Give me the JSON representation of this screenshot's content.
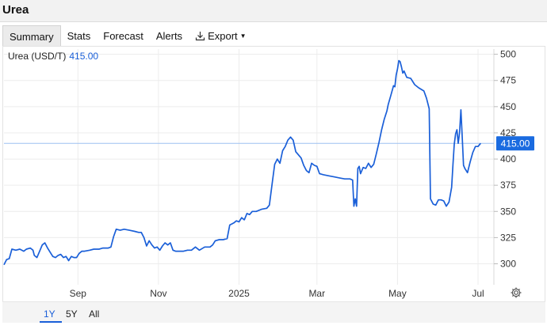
{
  "page": {
    "title": "Urea"
  },
  "tabs": [
    {
      "label": "Summary",
      "active": true
    },
    {
      "label": "Stats"
    },
    {
      "label": "Forecast"
    },
    {
      "label": "Alerts"
    },
    {
      "label": "Export",
      "icon": "download-icon"
    }
  ],
  "legend": {
    "name": "Urea (USD/T)",
    "value": "415.00"
  },
  "range_buttons": [
    {
      "label": "1Y",
      "active": true
    },
    {
      "label": "5Y"
    },
    {
      "label": "All"
    }
  ],
  "colors": {
    "line": "#1a5fd8",
    "grid": "#ececec",
    "ref_line": "#9ec0f0",
    "price_tag": "#1a6be0"
  },
  "icons": {
    "settings": "gear-icon"
  },
  "chart_data": {
    "type": "line",
    "title": "",
    "xlabel": "",
    "ylabel": "",
    "series": [
      {
        "name": "Urea (USD/T)"
      }
    ],
    "x_ticks": [
      "Sep",
      "Nov",
      "2025",
      "Mar",
      "May",
      "Jul"
    ],
    "x_tick_dates": [
      "2024-09-01",
      "2024-11-01",
      "2025-01-01",
      "2025-03-01",
      "2025-05-01",
      "2025-07-01"
    ],
    "y_ticks": [
      300,
      325,
      350,
      375,
      400,
      425,
      450,
      475,
      500
    ],
    "ylim": [
      280,
      505
    ],
    "xlim": [
      "2024-07-07",
      "2025-07-13"
    ],
    "last_value": 415.0,
    "last_value_label": "415.00",
    "grid": true,
    "y_axis_position": "right",
    "points": [
      [
        "2024-07-07",
        299
      ],
      [
        "2024-07-09",
        304
      ],
      [
        "2024-07-11",
        305
      ],
      [
        "2024-07-13",
        314
      ],
      [
        "2024-07-16",
        313
      ],
      [
        "2024-07-19",
        314
      ],
      [
        "2024-07-22",
        312
      ],
      [
        "2024-07-24",
        314
      ],
      [
        "2024-07-27",
        315
      ],
      [
        "2024-07-29",
        313
      ],
      [
        "2024-07-30",
        308
      ],
      [
        "2024-08-01",
        306
      ],
      [
        "2024-08-03",
        312
      ],
      [
        "2024-08-05",
        318
      ],
      [
        "2024-08-07",
        320
      ],
      [
        "2024-08-09",
        315
      ],
      [
        "2024-08-11",
        311
      ],
      [
        "2024-08-13",
        307
      ],
      [
        "2024-08-15",
        306
      ],
      [
        "2024-08-17",
        308
      ],
      [
        "2024-08-19",
        309
      ],
      [
        "2024-08-21",
        306
      ],
      [
        "2024-08-23",
        307
      ],
      [
        "2024-08-25",
        303
      ],
      [
        "2024-08-27",
        307
      ],
      [
        "2024-08-29",
        306
      ],
      [
        "2024-08-31",
        306
      ],
      [
        "2024-09-02",
        310
      ],
      [
        "2024-09-04",
        312
      ],
      [
        "2024-09-06",
        312
      ],
      [
        "2024-09-10",
        313
      ],
      [
        "2024-09-13",
        314
      ],
      [
        "2024-09-17",
        314
      ],
      [
        "2024-09-20",
        315
      ],
      [
        "2024-09-24",
        315
      ],
      [
        "2024-09-26",
        316
      ],
      [
        "2024-09-28",
        326
      ],
      [
        "2024-09-30",
        333
      ],
      [
        "2024-10-03",
        332
      ],
      [
        "2024-10-06",
        333
      ],
      [
        "2024-10-10",
        332
      ],
      [
        "2024-10-14",
        331
      ],
      [
        "2024-10-17",
        330
      ],
      [
        "2024-10-19",
        330
      ],
      [
        "2024-10-21",
        325
      ],
      [
        "2024-10-23",
        317
      ],
      [
        "2024-10-25",
        322
      ],
      [
        "2024-10-27",
        318
      ],
      [
        "2024-10-29",
        315
      ],
      [
        "2024-10-31",
        316
      ],
      [
        "2024-11-02",
        313
      ],
      [
        "2024-11-04",
        317
      ],
      [
        "2024-11-06",
        320
      ],
      [
        "2024-11-08",
        318
      ],
      [
        "2024-11-10",
        320
      ],
      [
        "2024-11-12",
        313
      ],
      [
        "2024-11-14",
        312
      ],
      [
        "2024-11-17",
        312
      ],
      [
        "2024-11-20",
        312
      ],
      [
        "2024-11-23",
        313
      ],
      [
        "2024-11-26",
        313
      ],
      [
        "2024-11-29",
        316
      ],
      [
        "2024-12-02",
        313
      ],
      [
        "2024-12-06",
        316
      ],
      [
        "2024-12-10",
        316
      ],
      [
        "2024-12-12",
        318
      ],
      [
        "2024-12-14",
        322
      ],
      [
        "2024-12-17",
        323
      ],
      [
        "2024-12-20",
        323
      ],
      [
        "2024-12-23",
        324
      ],
      [
        "2024-12-25",
        337
      ],
      [
        "2024-12-28",
        339
      ],
      [
        "2024-12-30",
        341
      ],
      [
        "2025-01-01",
        340
      ],
      [
        "2025-01-03",
        344
      ],
      [
        "2025-01-05",
        342
      ],
      [
        "2025-01-07",
        348
      ],
      [
        "2025-01-09",
        347
      ],
      [
        "2025-01-11",
        350
      ],
      [
        "2025-01-14",
        350
      ],
      [
        "2025-01-18",
        352
      ],
      [
        "2025-01-22",
        353
      ],
      [
        "2025-01-24",
        356
      ],
      [
        "2025-01-26",
        376
      ],
      [
        "2025-01-28",
        395
      ],
      [
        "2025-01-30",
        400
      ],
      [
        "2025-02-01",
        396
      ],
      [
        "2025-02-03",
        408
      ],
      [
        "2025-02-05",
        412
      ],
      [
        "2025-02-07",
        418
      ],
      [
        "2025-02-09",
        421
      ],
      [
        "2025-02-11",
        418
      ],
      [
        "2025-02-13",
        407
      ],
      [
        "2025-02-15",
        404
      ],
      [
        "2025-02-17",
        401
      ],
      [
        "2025-02-19",
        394
      ],
      [
        "2025-02-21",
        389
      ],
      [
        "2025-02-23",
        387
      ],
      [
        "2025-02-25",
        396
      ],
      [
        "2025-02-27",
        394
      ],
      [
        "2025-03-01",
        393
      ],
      [
        "2025-03-03",
        386
      ],
      [
        "2025-03-06",
        385
      ],
      [
        "2025-03-10",
        384
      ],
      [
        "2025-03-14",
        383
      ],
      [
        "2025-03-18",
        382
      ],
      [
        "2025-03-22",
        381
      ],
      [
        "2025-03-26",
        381
      ],
      [
        "2025-03-28",
        380
      ],
      [
        "2025-03-29",
        355
      ],
      [
        "2025-03-30",
        362
      ],
      [
        "2025-03-31",
        355
      ],
      [
        "2025-04-01",
        391
      ],
      [
        "2025-04-02",
        393
      ],
      [
        "2025-04-03",
        386
      ],
      [
        "2025-04-05",
        392
      ],
      [
        "2025-04-07",
        391
      ],
      [
        "2025-04-09",
        396
      ],
      [
        "2025-04-11",
        392
      ],
      [
        "2025-04-13",
        395
      ],
      [
        "2025-04-15",
        405
      ],
      [
        "2025-04-17",
        416
      ],
      [
        "2025-04-19",
        428
      ],
      [
        "2025-04-21",
        438
      ],
      [
        "2025-04-23",
        446
      ],
      [
        "2025-04-24",
        452
      ],
      [
        "2025-04-26",
        461
      ],
      [
        "2025-04-28",
        470
      ],
      [
        "2025-04-29",
        469
      ],
      [
        "2025-04-30",
        480
      ],
      [
        "2025-05-01",
        486
      ],
      [
        "2025-05-02",
        494
      ],
      [
        "2025-05-03",
        493
      ],
      [
        "2025-05-04",
        488
      ],
      [
        "2025-05-05",
        482
      ],
      [
        "2025-05-06",
        484
      ],
      [
        "2025-05-08",
        478
      ],
      [
        "2025-05-11",
        477
      ],
      [
        "2025-05-14",
        471
      ],
      [
        "2025-05-17",
        468
      ],
      [
        "2025-05-21",
        465
      ],
      [
        "2025-05-23",
        458
      ],
      [
        "2025-05-25",
        448
      ],
      [
        "2025-05-26",
        362
      ],
      [
        "2025-05-28",
        357
      ],
      [
        "2025-05-30",
        356
      ],
      [
        "2025-06-01",
        361
      ],
      [
        "2025-06-03",
        361
      ],
      [
        "2025-06-05",
        360
      ],
      [
        "2025-06-07",
        355
      ],
      [
        "2025-06-09",
        359
      ],
      [
        "2025-06-11",
        373
      ],
      [
        "2025-06-12",
        395
      ],
      [
        "2025-06-13",
        414
      ],
      [
        "2025-06-14",
        424
      ],
      [
        "2025-06-15",
        428
      ],
      [
        "2025-06-16",
        415
      ],
      [
        "2025-06-17",
        425
      ],
      [
        "2025-06-18",
        447
      ],
      [
        "2025-06-19",
        422
      ],
      [
        "2025-06-20",
        394
      ],
      [
        "2025-06-21",
        391
      ],
      [
        "2025-06-22",
        389
      ],
      [
        "2025-06-23",
        387
      ],
      [
        "2025-06-25",
        397
      ],
      [
        "2025-06-27",
        406
      ],
      [
        "2025-06-29",
        412
      ],
      [
        "2025-07-01",
        412
      ],
      [
        "2025-07-03",
        415
      ]
    ]
  }
}
